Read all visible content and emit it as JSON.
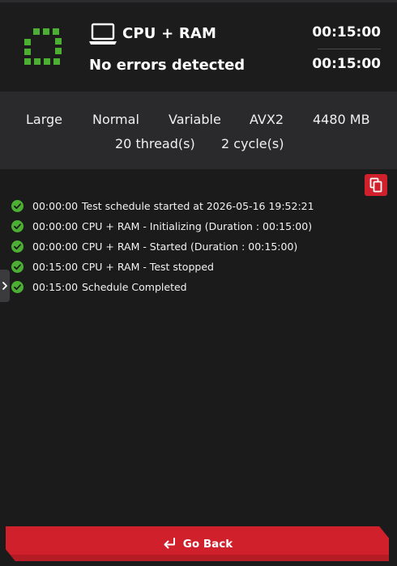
{
  "header": {
    "status_icon": "dashed-square-icon",
    "test_icon": "laptop-icon",
    "title": "CPU + RAM",
    "result": "No errors detected",
    "time_elapsed": "00:15:00",
    "time_total": "00:15:00"
  },
  "settings": {
    "size": "Large",
    "mode": "Normal",
    "pattern": "Variable",
    "instruction_set": "AVX2",
    "memory": "4480 MB",
    "threads": "20 thread(s)",
    "cycles": "2 cycle(s)"
  },
  "log": [
    {
      "time": "00:00:00",
      "message": "Test schedule started at 2026-05-16 19:52:21",
      "status_icon": "check-circle-icon"
    },
    {
      "time": "00:00:00",
      "message": "CPU + RAM - Initializing (Duration : 00:15:00)",
      "status_icon": "check-circle-icon"
    },
    {
      "time": "00:00:00",
      "message": "CPU + RAM - Started (Duration : 00:15:00)",
      "status_icon": "check-circle-icon"
    },
    {
      "time": "00:15:00",
      "message": "CPU + RAM - Test stopped",
      "status_icon": "check-circle-icon"
    },
    {
      "time": "00:15:00",
      "message": "Schedule Completed",
      "status_icon": "check-circle-icon"
    }
  ],
  "actions": {
    "copy_icon": "copy-icon",
    "expand_icon": "chevron-right-icon",
    "go_back_icon": "return-arrow-icon",
    "go_back_label": "Go Back"
  },
  "colors": {
    "accent_red": "#d0202c",
    "success_green": "#4caf34",
    "background": "#1b1b1c",
    "panel": "#2a2a2d"
  }
}
